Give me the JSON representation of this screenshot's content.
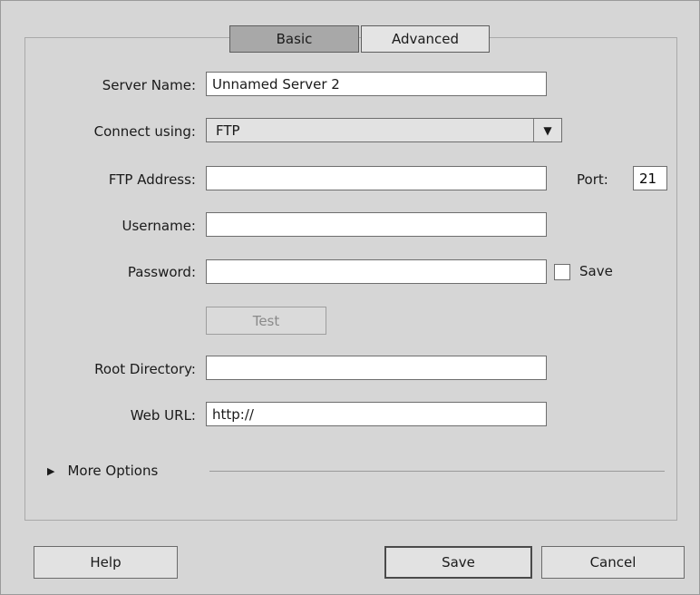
{
  "tabs": {
    "basic": "Basic",
    "advanced": "Advanced",
    "active": "Basic"
  },
  "form": {
    "server_name": {
      "label": "Server Name:",
      "value": "Unnamed Server 2"
    },
    "connect_using": {
      "label": "Connect using:",
      "value": "FTP"
    },
    "ftp_address": {
      "label": "FTP Address:",
      "value": ""
    },
    "port": {
      "label": "Port:",
      "value": "21"
    },
    "username": {
      "label": "Username:",
      "value": ""
    },
    "password": {
      "label": "Password:",
      "value": ""
    },
    "save_password": {
      "label": "Save",
      "checked": false
    },
    "test_button": "Test",
    "root_directory": {
      "label": "Root Directory:",
      "value": ""
    },
    "web_url": {
      "label": "Web URL:",
      "value": "http://"
    }
  },
  "more_options": {
    "label": "More Options",
    "icon": "triangle-right-icon"
  },
  "dropdown_icon": "triangle-down-icon",
  "footer": {
    "help": "Help",
    "save": "Save",
    "cancel": "Cancel"
  }
}
